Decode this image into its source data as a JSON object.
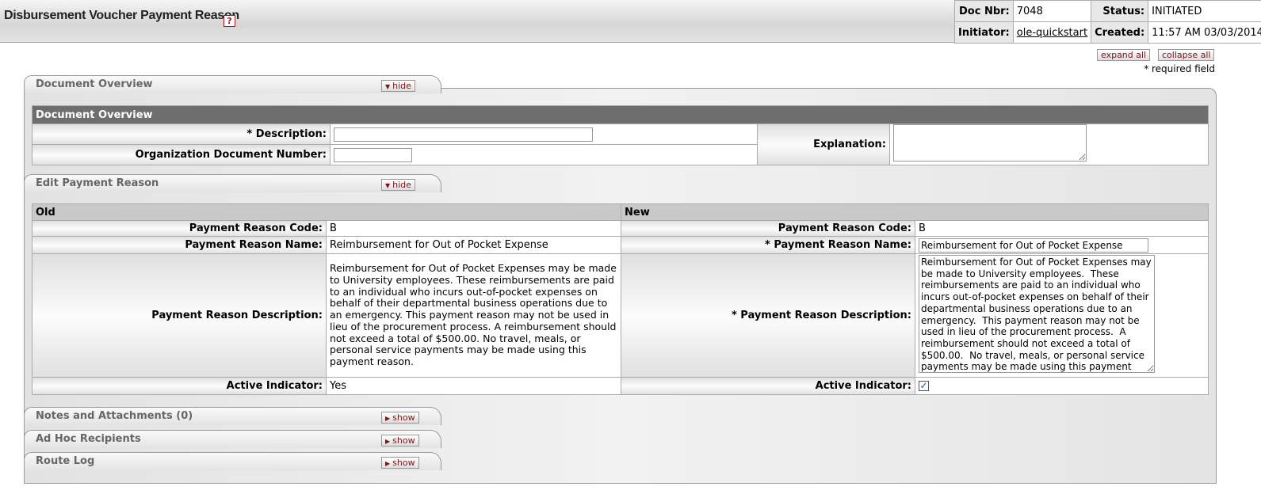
{
  "header": {
    "title": "Disbursement Voucher Payment Reason",
    "help_icon": "?",
    "doc_nbr_label": "Doc Nbr:",
    "doc_nbr": "7048",
    "status_label": "Status:",
    "status": "INITIATED",
    "initiator_label": "Initiator:",
    "initiator": "ole-quickstart",
    "created_label": "Created:",
    "created": "11:57 AM 03/03/2014"
  },
  "controls": {
    "expand_all": "expand all",
    "collapse_all": "collapse all",
    "required_note": "* required field"
  },
  "document_overview": {
    "tab_label": "Document Overview",
    "toggle": "hide",
    "section_title": "Document Overview",
    "description_label": "* Description:",
    "description_value": "",
    "org_doc_number_label": "Organization Document Number:",
    "org_doc_number_value": "",
    "explanation_label": "Explanation:",
    "explanation_value": ""
  },
  "edit_payment_reason": {
    "tab_label": "Edit Payment Reason",
    "toggle": "hide",
    "old_header": "Old",
    "new_header": "New",
    "old": {
      "code_label": "Payment Reason Code:",
      "code": "B",
      "name_label": "Payment Reason Name:",
      "name": "Reimbursement for Out of Pocket Expense",
      "description_label": "Payment Reason Description:",
      "description": "Reimbursement for Out of Pocket Expenses may be made to University employees. These reimbursements are paid to an individual who incurs out-of-pocket expenses on behalf of their departmental business operations due to an emergency. This payment reason may not be used in lieu of the procurement process. A reimbursement should not exceed a total of $500.00. No travel, meals, or personal service payments may be made using this payment reason.",
      "active_label": "Active Indicator:",
      "active": "Yes"
    },
    "new": {
      "code_label": "Payment Reason Code:",
      "code": "B",
      "name_label": "* Payment Reason Name:",
      "name": "Reimbursement for Out of Pocket Expense",
      "description_label": "* Payment Reason Description:",
      "description": "Reimbursement for Out of Pocket Expenses may be made to University employees.  These reimbursements are paid to an individual who incurs out-of-pocket expenses on behalf of their departmental business operations due to an emergency.  This payment reason may not be used in lieu of the procurement process.  A reimbursement should not exceed a total of $500.00.  No travel, meals, or personal service payments may be made using this payment reason.",
      "active_label": "Active Indicator:",
      "active_checked": true
    }
  },
  "notes": {
    "tab_label": "Notes and Attachments (0)",
    "toggle": "show"
  },
  "adhoc": {
    "tab_label": "Ad Hoc Recipients",
    "toggle": "show"
  },
  "route_log": {
    "tab_label": "Route Log",
    "toggle": "show"
  }
}
